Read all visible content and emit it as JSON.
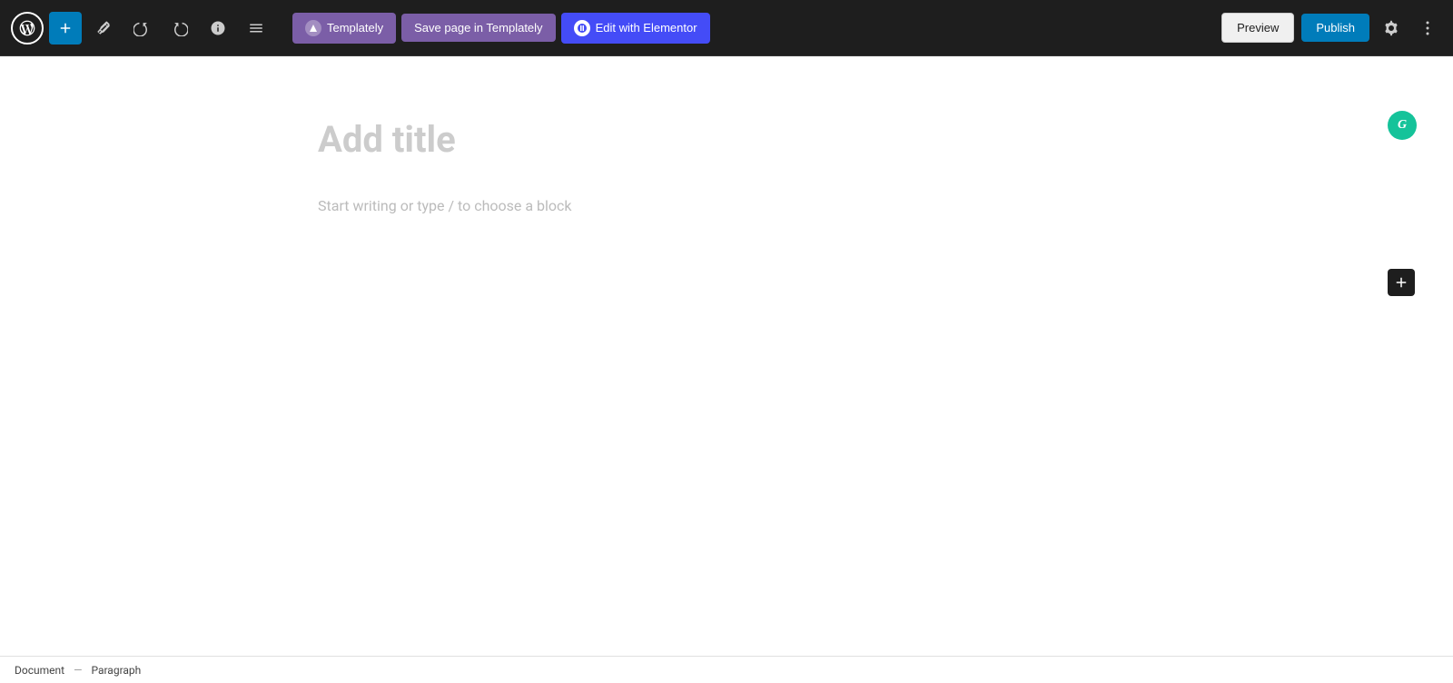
{
  "toolbar": {
    "add_label": "+",
    "undo_title": "Undo",
    "redo_title": "Redo",
    "details_title": "Details",
    "list_view_title": "List view",
    "templately_label": "Templately",
    "save_templately_label": "Save page in Templately",
    "elementor_label": "Edit with Elementor",
    "preview_label": "Preview",
    "publish_label": "Publish",
    "settings_title": "Settings",
    "more_title": "More"
  },
  "editor": {
    "title_placeholder": "Add title",
    "body_placeholder": "Start writing or type / to choose a block"
  },
  "floating": {
    "grammarly_letter": "G",
    "add_block_title": "Add block"
  },
  "bottom_bar": {
    "document_label": "Document",
    "separator": "—",
    "block_label": "Paragraph"
  }
}
